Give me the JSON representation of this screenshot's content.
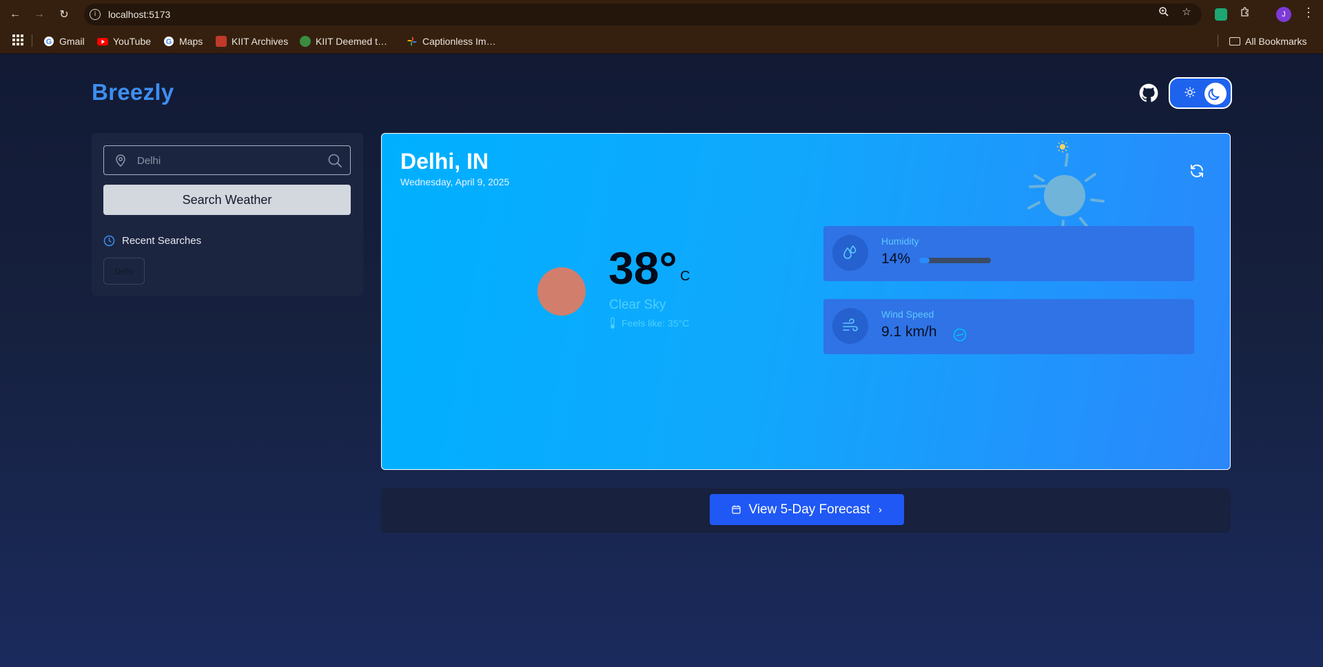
{
  "browser": {
    "url": "localhost:5173",
    "bookmarks": [
      {
        "label": "Gmail",
        "icon": "google-icon"
      },
      {
        "label": "YouTube",
        "icon": "youtube-icon"
      },
      {
        "label": "Maps",
        "icon": "google-icon"
      },
      {
        "label": "KIIT Archives",
        "icon": "kiit-icon"
      },
      {
        "label": "KIIT Deemed t…",
        "icon": "kiit-green-icon"
      },
      {
        "label": "Captionless Im…",
        "icon": "pinwheel-icon"
      }
    ],
    "all_bookmarks": "All Bookmarks",
    "profile_initial": "J"
  },
  "app": {
    "brand": "Breezly",
    "search": {
      "value": "Delhi",
      "button_label": "Search Weather"
    },
    "recent": {
      "heading": "Recent Searches",
      "items": [
        "Delhi"
      ]
    },
    "weather": {
      "city": "Delhi, IN",
      "date": "Wednesday, April 9, 2025",
      "temperature": "38°",
      "unit": "C",
      "condition": "Clear Sky",
      "feels_like": "Feels like: 35°C",
      "humidity": {
        "label": "Humidity",
        "value": "14%",
        "fraction": 0.14
      },
      "wind": {
        "label": "Wind Speed",
        "value": "9.1 km/h"
      }
    },
    "forecast_button": "View 5-Day Forecast"
  },
  "colors": {
    "brand": "#3e8ef0",
    "card_gradient_start": "#00b0ff",
    "card_gradient_end": "#2b87fb",
    "primary_button": "#1f58f5"
  }
}
